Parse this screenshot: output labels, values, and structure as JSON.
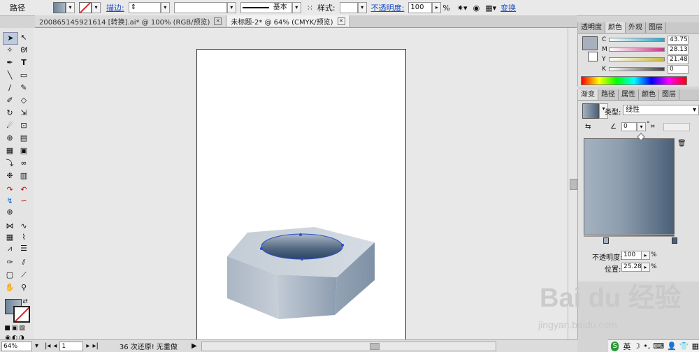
{
  "toolbar": {
    "label_path": "路径",
    "stroke_label": "描边:",
    "stroke_style": "基本",
    "style_label": "样式:",
    "opacity_label": "不透明度:",
    "opacity_value": "100",
    "opacity_unit": "%",
    "transform_label": "变换"
  },
  "tabs": [
    {
      "label": "200865145921614 [转换].ai* @ 100% (RGB/预览)",
      "active": false
    },
    {
      "label": "未标题-2* @ 64% (CMYK/预览)",
      "active": true
    }
  ],
  "status": {
    "zoom": "64%",
    "page": "1",
    "undo_text": "36 次还原! 无重做"
  },
  "color_panel": {
    "tabs": [
      "透明度",
      "颜色",
      "外观",
      "图层"
    ],
    "active_tab": "颜色",
    "channels": [
      {
        "name": "C",
        "value": "43.75",
        "color": "#2aa7c9"
      },
      {
        "name": "M",
        "value": "28.13",
        "color": "#c43a86"
      },
      {
        "name": "Y",
        "value": "21.48",
        "color": "#c9b83a"
      },
      {
        "name": "K",
        "value": "0",
        "color": "#444444"
      }
    ]
  },
  "gradient_panel": {
    "tabs": [
      "渐变",
      "路径",
      "属性",
      "颜色",
      "图层"
    ],
    "active_tab": "渐变",
    "type_label": "类型:",
    "type_value": "线性",
    "angle_value": "0",
    "angle_unit": "°",
    "opacity_label": "不透明度:",
    "opacity_value": "100",
    "position_label": "位置:",
    "position_value": "25.28",
    "unit": "%",
    "start_color": "#a4b1bf",
    "end_color": "#4a6078"
  },
  "watermark": {
    "brand": "Bai du 经验",
    "url": "jingyan.baidu.com"
  },
  "ime": {
    "lang": "英"
  }
}
